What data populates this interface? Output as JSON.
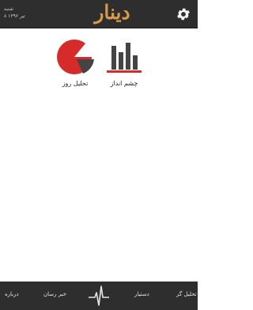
{
  "header": {
    "day": "شنبه",
    "date": "۸ تیر ۱۳۹۶",
    "logo": "دینار",
    "settings_icon": "gear-icon"
  },
  "tiles": [
    {
      "label": "چشم انداز",
      "icon": "bar-chart-icon"
    },
    {
      "label": "تحلیل روز",
      "icon": "pie-chart-icon"
    }
  ],
  "bottom_nav": {
    "analyst": "تحلیل گر",
    "assistant": "دستیار",
    "center_icon": "pulse-icon",
    "news": "خبر رسان",
    "about": "درباره"
  },
  "colors": {
    "bar_dark": "#444444",
    "accent_red": "#d62b2b",
    "logo": "#d89a4a",
    "header_bg": "#2e2e2e"
  }
}
